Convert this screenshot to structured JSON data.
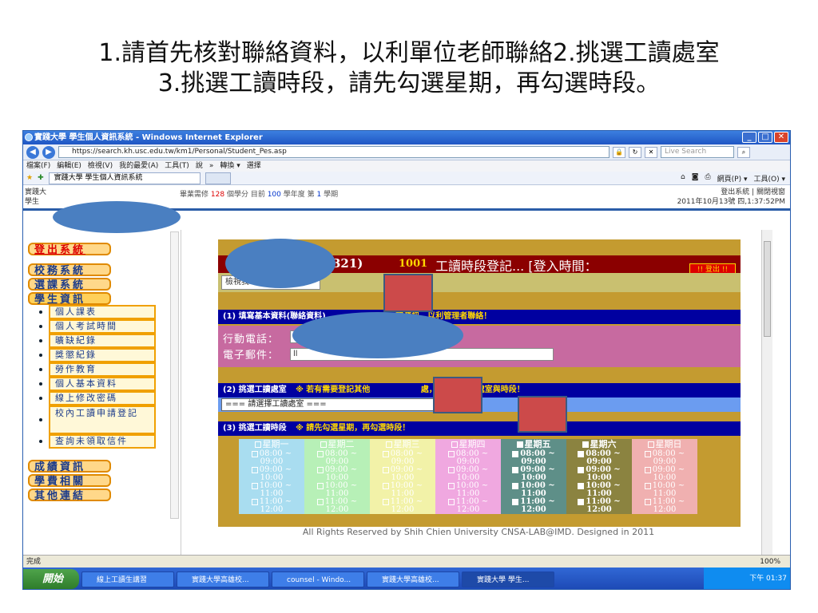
{
  "slide": {
    "line1": "1.請首先核對聯絡資料，以利單位老師聯絡2.挑選工讀處室",
    "line2": "3.挑選工讀時段，請先勾選星期，再勾選時段。"
  },
  "window": {
    "title": "實踐大學 學生個人資訊系統 - Windows Internet Explorer",
    "url": "https://search.kh.usc.edu.tw/km1/Personal/Student_Pes.asp",
    "search_placeholder": "Live Search",
    "menu": [
      "檔案(F)",
      "編輯(E)",
      "檢視(V)",
      "我的最愛(A)",
      "工具(T)",
      "說",
      "»",
      "轉換 ▾",
      "選擇"
    ],
    "tab_label": "實踐大學 學生個人資訊系統",
    "fav_tools": [
      "網頁(P) ▾",
      "工具(O) ▾"
    ]
  },
  "topinfo": {
    "left_line1": "實踐大",
    "left_line2": "學生",
    "mid_a": "畢業需修",
    "mid_credits": "128",
    "mid_b": "個學分 目前",
    "mid_year": "100",
    "mid_c": "學年度 第",
    "mid_term": "1",
    "mid_d": "學期",
    "right_line1": "登出系統 | 關閉視窗",
    "right_line2": "2011年10月13號 四,1:37:52PM"
  },
  "sidebar": {
    "logout": "登出系統",
    "sections": [
      "校務系統",
      "選課系統",
      "學生資訊"
    ],
    "items": [
      "個人課表",
      "個人考試時間",
      "曠缺紀錄",
      "獎懲紀錄",
      "勞作教育",
      "個人基本資料",
      "線上修改密碼",
      "校內工讀申請登記",
      "查詢未領取信件"
    ],
    "bottom": [
      "成績資訊",
      "學費相關",
      "其他連結"
    ]
  },
  "content": {
    "header_num": "321)",
    "header_year": "1001",
    "header_title": "工讀時段登記... [登入時間：",
    "logout_small": "!! 登出 !!",
    "check_input": "檢視我",
    "check_suffix": "紀",
    "sec1_title": "(1) 填寫基本資料(聯絡資料)",
    "sec1_note": "確資訊，以利管理者聯絡！",
    "phone_label": "行動電話：",
    "phone_value": "09",
    "email_label": "電子郵件：",
    "email_value": "ll",
    "sec2_title": "(2) 挑選工讀處室",
    "sec2_note": "※ 若有需要登記其他",
    "sec2_note2": "處，請重複挑選處室與時段！",
    "select_value": "=== 請選擇工讀處室 ===",
    "sec3_title": "(3) 挑選工讀時段",
    "sec3_note": "※ 請先勾選星期，再勾選時段！",
    "days": [
      "星期一",
      "星期二",
      "星期三",
      "星期四",
      "星期五",
      "星期六",
      "星期日"
    ],
    "slots": [
      "08:00 ~|09:00",
      "09:00 ~|10:00",
      "10:00 ~|11:00",
      "11:00 ~|12:00"
    ],
    "footer": "All Rights Reserved by Shih Chien University  CNSA-LAB@IMD. Designed in 2011"
  },
  "statusbar": {
    "left": "完成",
    "zoom": "100%"
  },
  "taskbar": {
    "start": "開始",
    "items": [
      "線上工讀生講習",
      "實踐大學高雄校...",
      "counsel - Windo...",
      "實踐大學高雄校...",
      "實踐大學 學生..."
    ],
    "clock": "下午 01:37"
  },
  "colors": {
    "days": [
      "#a9ddf0",
      "#b7f0b7",
      "#f2f2a8",
      "#f0a8e0",
      "#5e8f88",
      "#8b8340",
      "#f0b0b0"
    ]
  }
}
